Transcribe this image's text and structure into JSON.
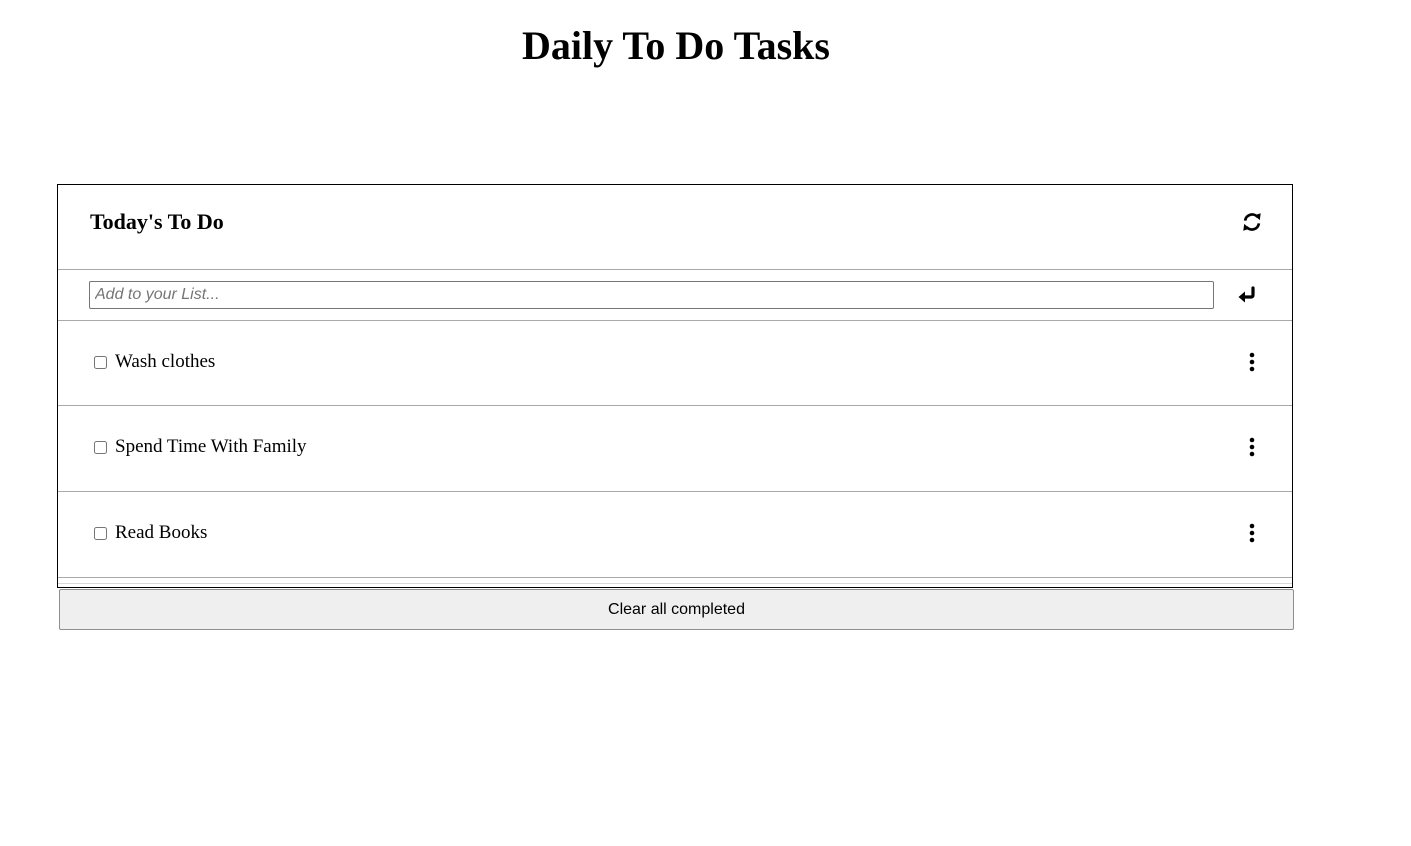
{
  "page": {
    "title": "Daily To Do Tasks"
  },
  "card": {
    "title": "Today's To Do",
    "refresh_icon": "refresh-icon"
  },
  "add": {
    "placeholder": "Add to your List...",
    "value": "",
    "submit_icon": "enter-return-icon"
  },
  "tasks": [
    {
      "label": "Wash clothes",
      "checked": false,
      "menu_icon": "vertical-ellipsis-icon"
    },
    {
      "label": "Spend Time With Family",
      "checked": false,
      "menu_icon": "vertical-ellipsis-icon"
    },
    {
      "label": "Read Books",
      "checked": false,
      "menu_icon": "vertical-ellipsis-icon"
    }
  ],
  "footer": {
    "clear_label": "Clear all completed"
  }
}
